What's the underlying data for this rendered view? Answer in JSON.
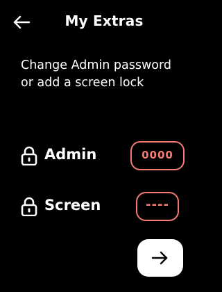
{
  "header": {
    "title": "My Extras",
    "back_icon": "arrow-left-icon"
  },
  "description": "Change Admin password or add a screen lock",
  "rows": [
    {
      "label": "Admin",
      "icon": "lock-icon",
      "value": "0000"
    },
    {
      "label": "Screen",
      "icon": "lock-icon",
      "value": "----"
    }
  ],
  "next_icon": "arrow-right-icon",
  "colors": {
    "background": "#000000",
    "text": "#ffffff",
    "accent": "#f37b72",
    "button_bg": "#ffffff"
  }
}
